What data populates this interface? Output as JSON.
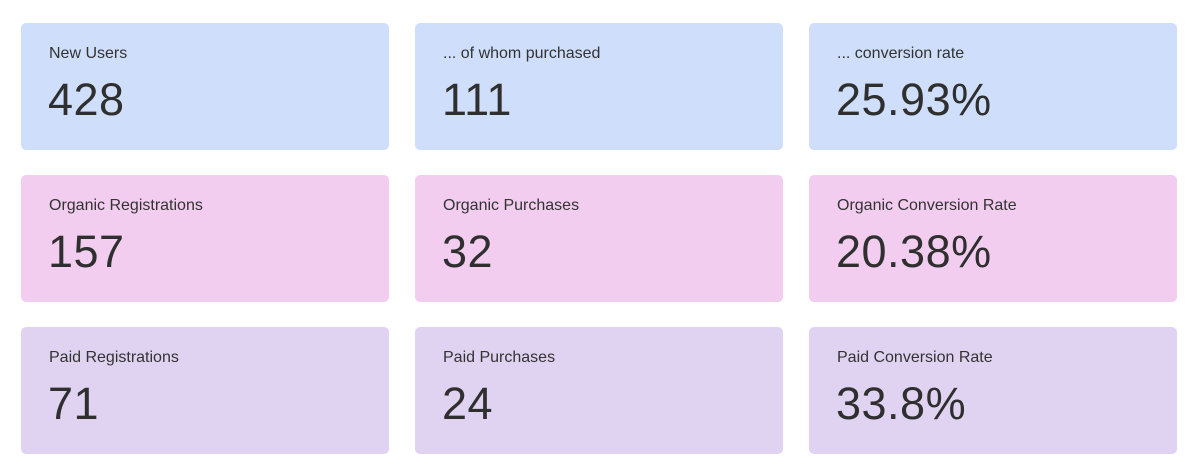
{
  "colors": {
    "overall": "#cfdefa",
    "organic": "#f2cdef",
    "paid": "#e0d3f2"
  },
  "rows": [
    {
      "group": "overall",
      "cards": [
        {
          "label": "New Users",
          "value": "428"
        },
        {
          "label": "... of whom purchased",
          "value": "111"
        },
        {
          "label": "... conversion rate",
          "value": "25.93%"
        }
      ]
    },
    {
      "group": "organic",
      "cards": [
        {
          "label": "Organic Registrations",
          "value": "157"
        },
        {
          "label": "Organic Purchases",
          "value": "32"
        },
        {
          "label": "Organic Conversion Rate",
          "value": "20.38%"
        }
      ]
    },
    {
      "group": "paid",
      "cards": [
        {
          "label": "Paid Registrations",
          "value": "71"
        },
        {
          "label": "Paid Purchases",
          "value": "24"
        },
        {
          "label": "Paid Conversion Rate",
          "value": "33.8%"
        }
      ]
    }
  ]
}
